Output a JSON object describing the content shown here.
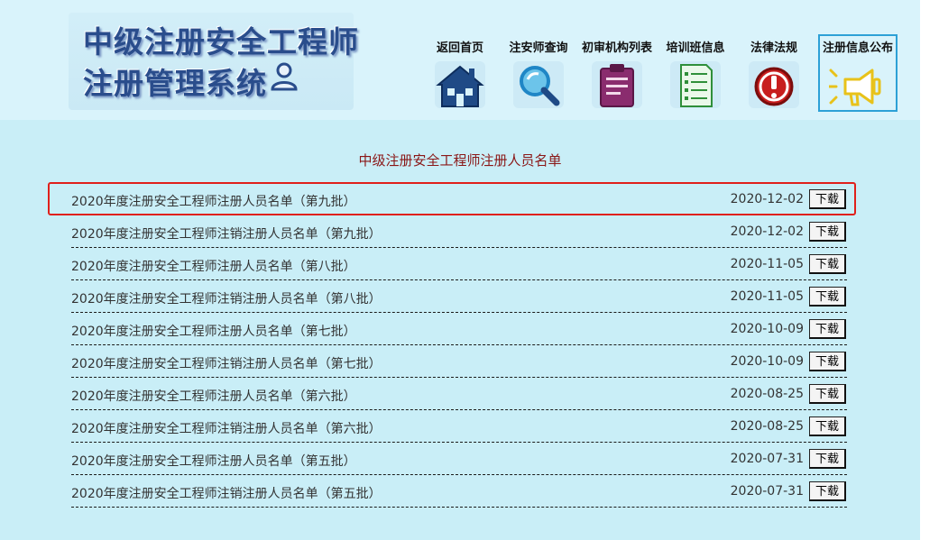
{
  "logo": {
    "line1": "中级注册安全工程师",
    "line2": "注册管理系统"
  },
  "nav": [
    {
      "label": "返回首页",
      "icon": "home-icon"
    },
    {
      "label": "注安师查询",
      "icon": "magnifier-icon"
    },
    {
      "label": "初审机构列表",
      "icon": "clipboard-icon"
    },
    {
      "label": "培训班信息",
      "icon": "checklist-icon"
    },
    {
      "label": "法律法规",
      "icon": "alert-icon"
    },
    {
      "label": "注册信息公布",
      "icon": "megaphone-icon",
      "active": true
    }
  ],
  "list_title": "中级注册安全工程师注册人员名单",
  "download_label": "下载",
  "rows": [
    {
      "name": "2020年度注册安全工程师注册人员名单（第九批）",
      "date": "2020-12-02"
    },
    {
      "name": "2020年度注册安全工程师注销注册人员名单（第九批）",
      "date": "2020-12-02"
    },
    {
      "name": "2020年度注册安全工程师注册人员名单（第八批）",
      "date": "2020-11-05"
    },
    {
      "name": "2020年度注册安全工程师注销注册人员名单（第八批）",
      "date": "2020-11-05"
    },
    {
      "name": "2020年度注册安全工程师注册人员名单（第七批）",
      "date": "2020-10-09"
    },
    {
      "name": "2020年度注册安全工程师注销注册人员名单（第七批）",
      "date": "2020-10-09"
    },
    {
      "name": "2020年度注册安全工程师注册人员名单（第六批）",
      "date": "2020-08-25"
    },
    {
      "name": "2020年度注册安全工程师注销注册人员名单（第六批）",
      "date": "2020-08-25"
    },
    {
      "name": "2020年度注册安全工程师注册人员名单（第五批）",
      "date": "2020-07-31"
    },
    {
      "name": "2020年度注册安全工程师注销注册人员名单（第五批）",
      "date": "2020-07-31"
    }
  ],
  "colors": {
    "page_bg": "#c9eef7",
    "header_bg": "#d9f3fb",
    "title": "#8a1717",
    "highlight": "#e0201b",
    "active_nav_border": "#2ca0d6"
  }
}
